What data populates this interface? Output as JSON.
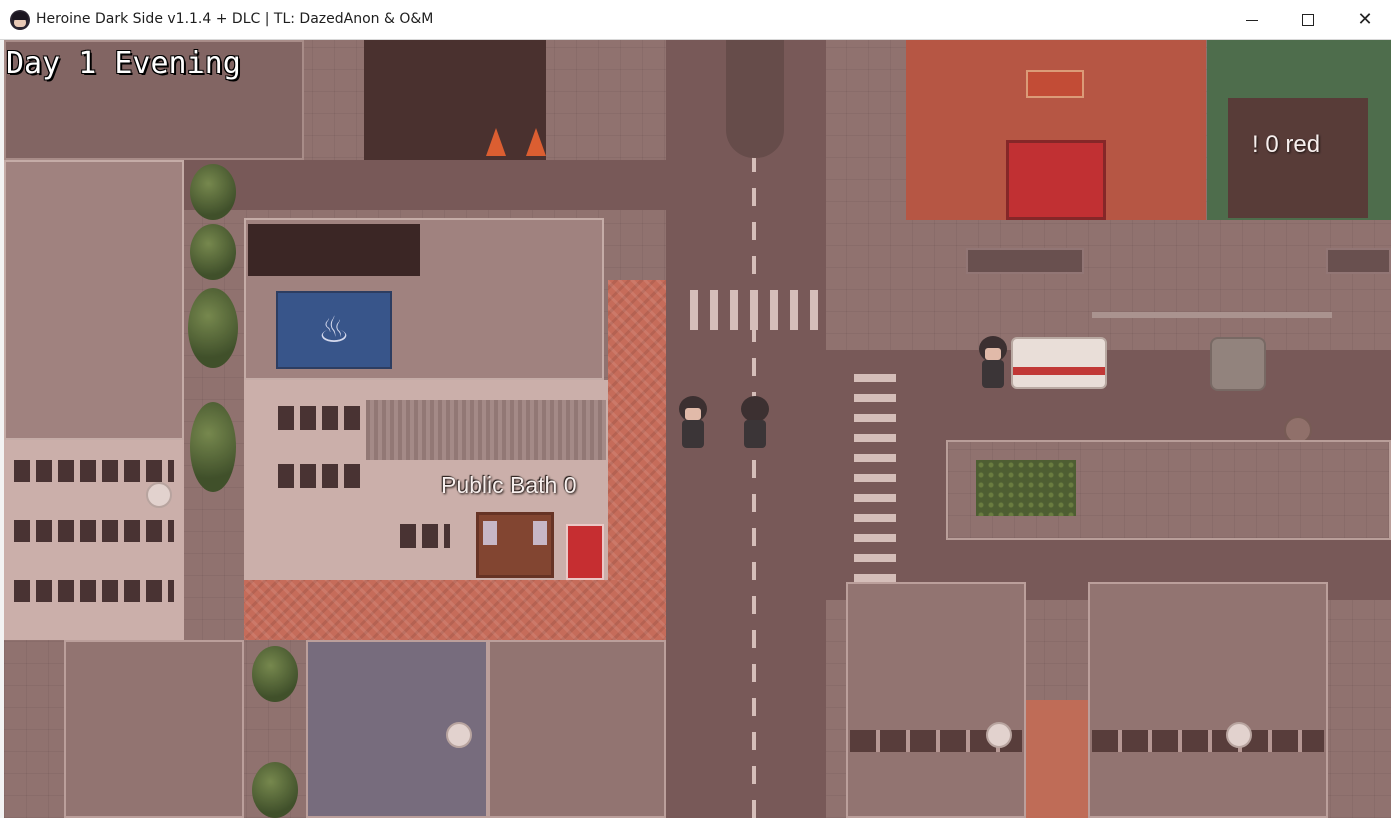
{
  "window": {
    "title": "Heroine Dark Side v1.1.4 + DLC | TL: DazedAnon & O&M",
    "controls": {
      "minimize": "minimize",
      "maximize": "maximize",
      "close": "✕"
    }
  },
  "hud": {
    "day_time": "Day 1 Evening"
  },
  "map_labels": {
    "public_bath": "Public Bath 0",
    "shop_counter": "!  0 red"
  },
  "icons": {
    "bath_sign": "♨"
  },
  "colors": {
    "road": "#6f5556",
    "brick": "#c86a58",
    "bath_sign": "#26508f"
  }
}
